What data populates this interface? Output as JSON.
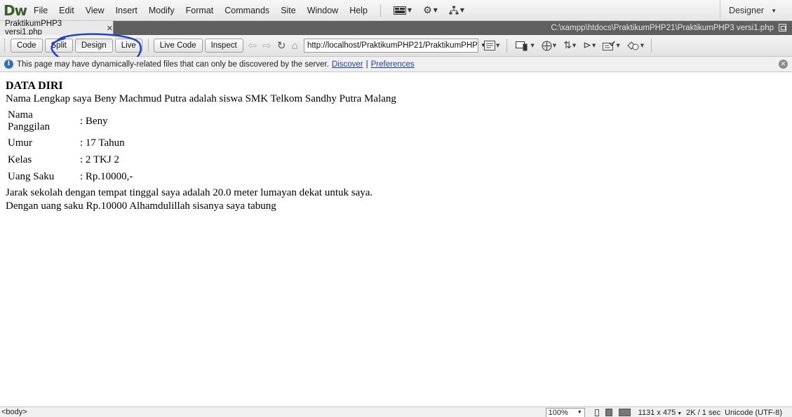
{
  "app": {
    "logo": "Dw",
    "menu": [
      "File",
      "Edit",
      "View",
      "Insert",
      "Modify",
      "Format",
      "Commands",
      "Site",
      "Window",
      "Help"
    ],
    "workspace": "Designer"
  },
  "document": {
    "tab_title": "PraktikumPHP3 versi1.php",
    "file_path": "C:\\xampp\\htdocs\\PraktikumPHP21\\PraktikumPHP3 versi1.php"
  },
  "toolbar": {
    "code_label": "Code",
    "split_label": "Split",
    "design_label": "Design",
    "live_label": "Live",
    "live_code_label": "Live Code",
    "inspect_label": "Inspect",
    "address": "http://localhost/PraktikumPHP21/PraktikumPHP"
  },
  "infobar": {
    "message": "This page may have dynamically-related files that can only be discovered by the server.",
    "discover_link": "Discover",
    "separator": "|",
    "preferences_link": "Preferences"
  },
  "content": {
    "heading": "DATA DIRI",
    "intro": "Nama Lengkap saya Beny Machmud Putra adalah siswa SMK Telkom Sandhy Putra Malang",
    "rows": [
      {
        "label": "Nama Panggilan",
        "value": ": Beny"
      },
      {
        "label": "Umur",
        "value": ": 17 Tahun"
      },
      {
        "label": "Kelas",
        "value": ": 2 TKJ 2"
      },
      {
        "label": "Uang Saku",
        "value": ": Rp.10000,-"
      }
    ],
    "line1": "Jarak sekolah dengan tempat tinggal saya adalah 20.0 meter lumayan dekat untuk saya.",
    "line2": "Dengan uang saku Rp.10000 Alhamdulillah sisanya saya tabung"
  },
  "statusbar": {
    "tag": "<body>",
    "zoom": "100%",
    "dimensions": "1131 x 475",
    "download": "2K / 1 sec",
    "encoding": "Unicode (UTF-8)"
  },
  "colors": {
    "annotation": "#1f3fd6",
    "logo": "#3b5f2a",
    "link": "#1a3fb0"
  }
}
